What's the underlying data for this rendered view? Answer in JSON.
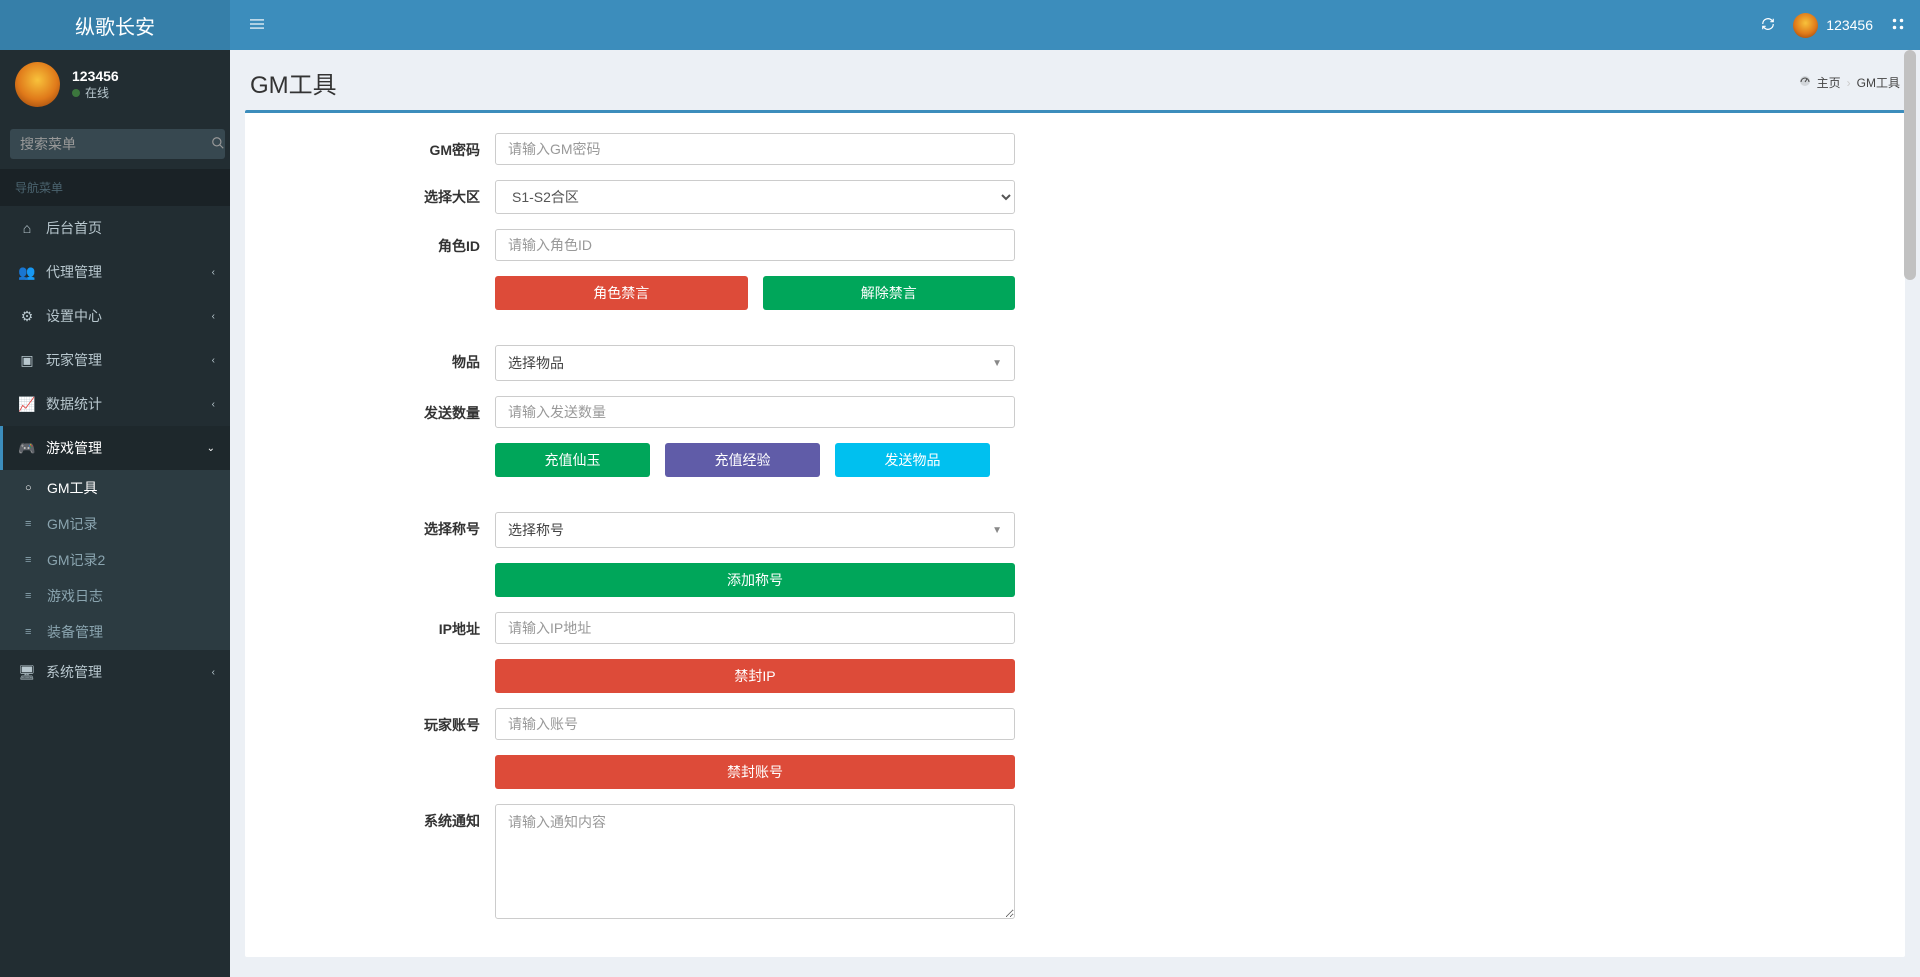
{
  "app": {
    "name": "纵歌长安"
  },
  "user": {
    "name": "123456",
    "status_text": "在线"
  },
  "topnav": {
    "user_label": "123456"
  },
  "sidebar": {
    "search_placeholder": "搜索菜单",
    "nav_header": "导航菜单",
    "items": {
      "home": "后台首页",
      "agent": "代理管理",
      "settings": "设置中心",
      "player": "玩家管理",
      "stats": "数据统计",
      "game": "游戏管理",
      "system": "系统管理"
    },
    "game_sub": {
      "gm_tools": "GM工具",
      "gm_log": "GM记录",
      "gm_log2": "GM记录2",
      "game_log": "游戏日志",
      "equip": "装备管理"
    }
  },
  "page": {
    "title": "GM工具"
  },
  "breadcrumb": {
    "home": "主页",
    "current": "GM工具"
  },
  "form": {
    "gm_password_label": "GM密码",
    "gm_password_placeholder": "请输入GM密码",
    "zone_label": "选择大区",
    "zone_option": "S1-S2合区",
    "role_id_label": "角色ID",
    "role_id_placeholder": "请输入角色ID",
    "btn_role_ban": "角色禁言",
    "btn_role_unban": "解除禁言",
    "item_label": "物品",
    "item_placeholder": "选择物品",
    "send_qty_label": "发送数量",
    "send_qty_placeholder": "请输入发送数量",
    "btn_recharge_jade": "充值仙玉",
    "btn_recharge_exp": "充值经验",
    "btn_send_item": "发送物品",
    "title_label": "选择称号",
    "title_placeholder": "选择称号",
    "btn_add_title": "添加称号",
    "ip_label": "IP地址",
    "ip_placeholder": "请输入IP地址",
    "btn_ban_ip": "禁封IP",
    "account_label": "玩家账号",
    "account_placeholder": "请输入账号",
    "btn_ban_account": "禁封账号",
    "notice_label": "系统通知",
    "notice_placeholder": "请输入通知内容"
  }
}
